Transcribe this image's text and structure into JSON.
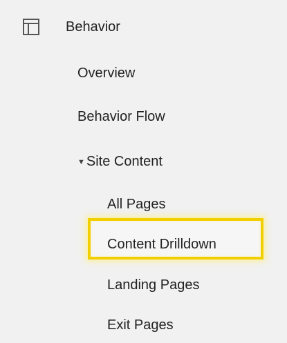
{
  "section": {
    "label": "Behavior",
    "icon": "layout-icon"
  },
  "items": [
    {
      "label": "Overview"
    },
    {
      "label": "Behavior Flow"
    },
    {
      "label": "Site Content",
      "expanded": true,
      "caret_icon": "caret-down-icon"
    },
    {
      "label": "All Pages"
    },
    {
      "label": "Content Drilldown",
      "highlighted": true,
      "highlight_color": "#f2cf00"
    },
    {
      "label": "Landing Pages"
    },
    {
      "label": "Exit Pages"
    }
  ]
}
